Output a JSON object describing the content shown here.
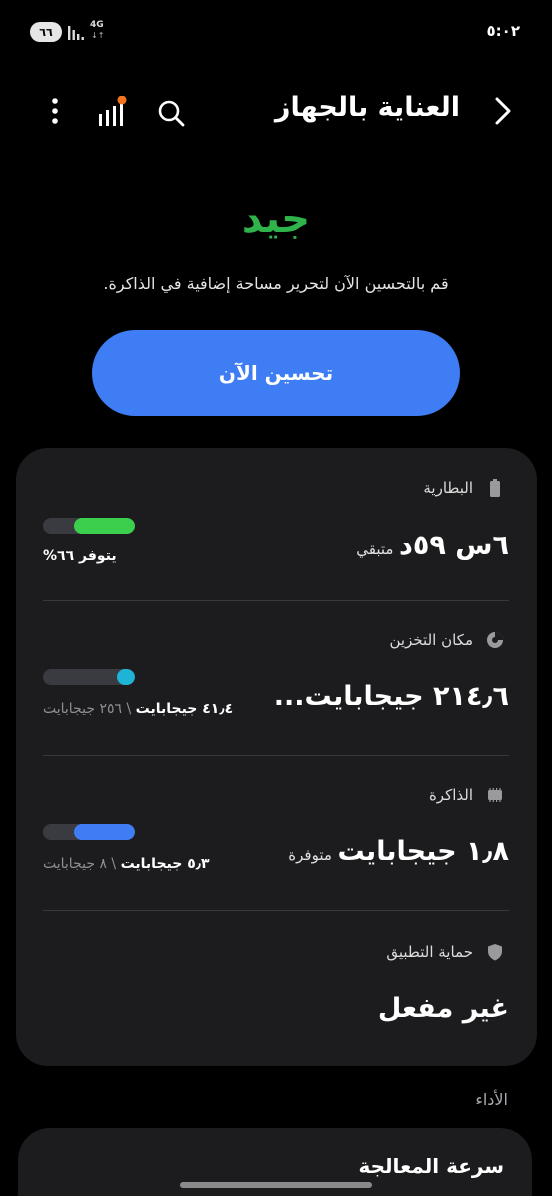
{
  "status_bar": {
    "battery_level": "٦٦",
    "network_type": "4G",
    "time": "٥:٠٢"
  },
  "header": {
    "title": "العناية بالجهاز",
    "icons": [
      "back-arrow-icon",
      "search-icon",
      "bar-chart-icon",
      "more-vert-icon"
    ],
    "notification_dot_color": "#f3741d"
  },
  "device_status": {
    "rating": "جيد",
    "rating_color": "#2fb34a",
    "message": "قم بالتحسين الآن لتحرير مساحة إضافية في الذاكرة.",
    "optimize_button": "تحسين الآن",
    "button_color": "#3f7df5"
  },
  "battery": {
    "label": "البطارية",
    "value_main": "٦س ٥٩د",
    "value_suffix": "متبقي",
    "sub": "يتوفر ٦٦%",
    "level": 0.66,
    "bar_color": "#3ccf4e"
  },
  "storage": {
    "label": "مكان التخزين",
    "value_main": "٢١٤٫٦ جيجابايت...",
    "used": "٤١٫٤ جيجابايت",
    "separator": " \\ ",
    "total": "٢٥٦ جيجابايت",
    "level": 0.16,
    "bar_color": "#1fb4d6"
  },
  "memory": {
    "label": "الذاكرة",
    "value_main": "١٫٨ جيجابايت",
    "value_suffix": "متوفرة",
    "used": "٥٫٣ جيجابايت",
    "separator": " \\ ",
    "total": "٨ جيجابايت",
    "level": 0.66,
    "bar_color": "#3f7df5"
  },
  "app_protection": {
    "label": "حماية التطبيق",
    "value": "غير مفعل"
  },
  "performance": {
    "section_label": "الأداء",
    "item_title": "سرعة المعالجة"
  }
}
